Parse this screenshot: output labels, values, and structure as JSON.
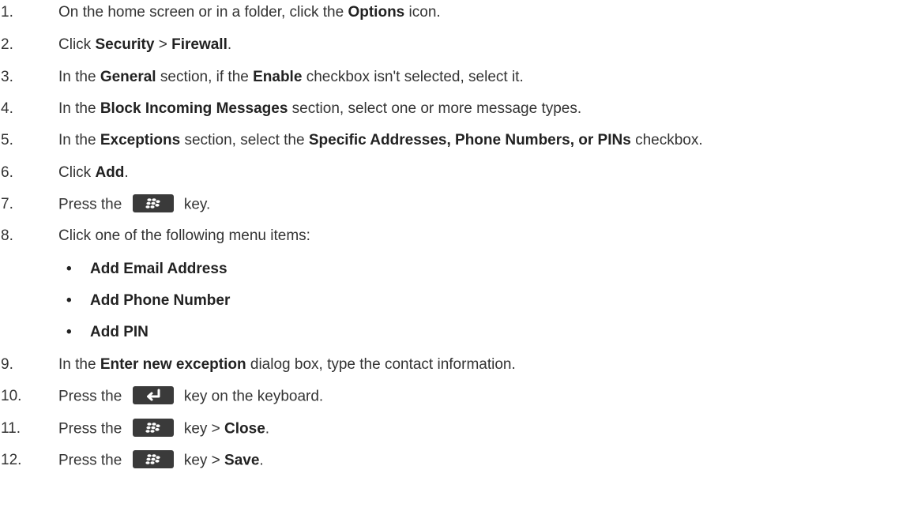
{
  "steps": [
    {
      "num": "1.",
      "parts": [
        "On the home screen or in a folder, click the ",
        "Options",
        " icon."
      ]
    },
    {
      "num": "2.",
      "parts": [
        "Click ",
        "Security",
        " > ",
        "Firewall",
        "."
      ]
    },
    {
      "num": "3.",
      "parts": [
        "In the ",
        "General",
        " section, if the ",
        "Enable",
        " checkbox isn't selected, select it."
      ]
    },
    {
      "num": "4.",
      "parts": [
        "In the ",
        "Block Incoming Messages",
        " section, select one or more message types."
      ]
    },
    {
      "num": "5.",
      "parts": [
        "In the ",
        "Exceptions",
        " section, select the ",
        "Specific Addresses, Phone Numbers, or PINs",
        " checkbox."
      ]
    },
    {
      "num": "6.",
      "parts": [
        "Click ",
        "Add",
        "."
      ]
    },
    {
      "num": "7.",
      "parts": [
        "Press the ",
        " key."
      ]
    },
    {
      "num": "8.",
      "parts": [
        "Click one of the following menu items:"
      ]
    },
    {
      "num": "9.",
      "parts": [
        "In the ",
        "Enter new exception",
        " dialog box, type the contact information."
      ]
    },
    {
      "num": "10.",
      "parts": [
        "Press the ",
        " key on the keyboard."
      ]
    },
    {
      "num": "11.",
      "parts": [
        "Press the ",
        " key > ",
        "Close",
        "."
      ]
    },
    {
      "num": "12.",
      "parts": [
        "Press the ",
        " key > ",
        "Save",
        "."
      ]
    }
  ],
  "menu_items": [
    "Add Email Address",
    "Add Phone Number",
    "Add PIN"
  ],
  "bullet": "•",
  "icons": {
    "menu_key": "blackberry-menu-key-icon",
    "enter_key": "enter-key-icon"
  },
  "colors": {
    "text": "#333333",
    "key_background": "#3a3a3a",
    "key_glyph": "#ffffff"
  }
}
